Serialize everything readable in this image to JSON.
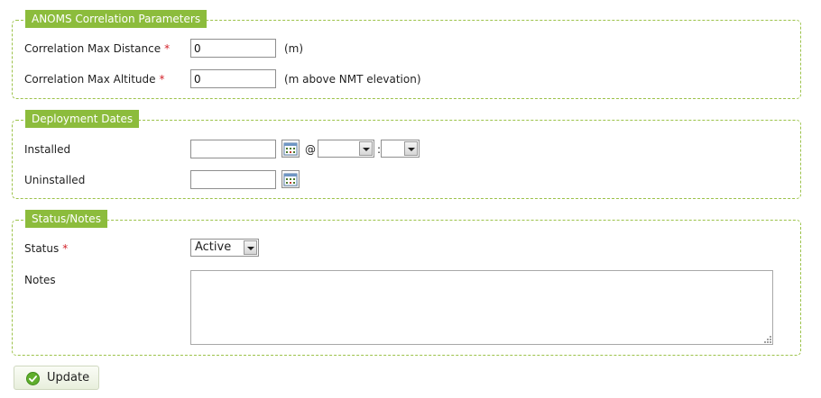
{
  "correlation": {
    "legend": "ANOMS Correlation Parameters",
    "max_distance": {
      "label": "Correlation Max Distance",
      "required": "*",
      "value": "0",
      "unit": "(m)"
    },
    "max_altitude": {
      "label": "Correlation Max Altitude",
      "required": "*",
      "value": "0",
      "unit": "(m above NMT elevation)"
    }
  },
  "deployment": {
    "legend": "Deployment Dates",
    "installed": {
      "label": "Installed",
      "value": "",
      "at": "@",
      "colon": ":",
      "hour": "",
      "minute": ""
    },
    "uninstalled": {
      "label": "Uninstalled",
      "value": ""
    }
  },
  "status_notes": {
    "legend": "Status/Notes",
    "status": {
      "label": "Status",
      "required": "*",
      "value": "Active"
    },
    "notes": {
      "label": "Notes",
      "value": ""
    }
  },
  "actions": {
    "update_label": "Update"
  },
  "colors": {
    "legend_bg": "#8cbc3c",
    "border": "#9cc24a",
    "required": "#d3222a",
    "check_icon": "#5fae2c"
  },
  "icons": {
    "calendar": "calendar-icon",
    "dropdown": "chevron-down-icon",
    "update": "check-circle-icon",
    "resize": "resize-grip-icon"
  }
}
